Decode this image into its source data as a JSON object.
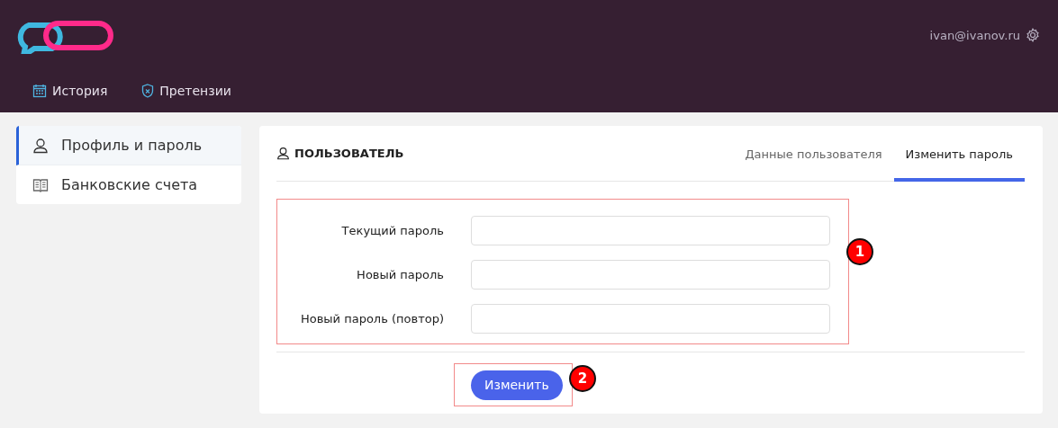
{
  "header": {
    "nav": [
      {
        "label": "История",
        "kind": "calendar"
      },
      {
        "label": "Претензии",
        "kind": "shield"
      }
    ],
    "user": "ivan@ivanov.ru"
  },
  "sidebar": {
    "items": [
      {
        "label": "Профиль и пароль",
        "kind": "user",
        "selected": true
      },
      {
        "label": "Банковские счета",
        "kind": "book",
        "selected": false
      }
    ]
  },
  "card": {
    "title": "ПОЛЬЗОВАТЕЛЬ",
    "tabs": [
      {
        "label": "Данные пользователя",
        "selected": false
      },
      {
        "label": "Изменить пароль",
        "selected": true
      }
    ],
    "fields": [
      {
        "label": "Текущий пароль"
      },
      {
        "label": "Новый пароль"
      },
      {
        "label": "Новый пароль (повтор)"
      }
    ],
    "submit": "Изменить"
  },
  "annotations": [
    "1",
    "2"
  ]
}
